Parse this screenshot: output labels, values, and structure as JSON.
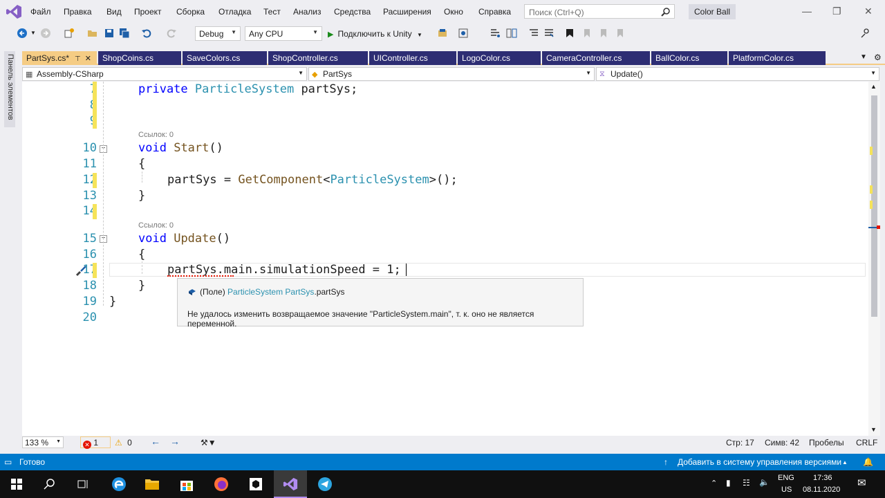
{
  "menu": {
    "items": [
      "Файл",
      "Правка",
      "Вид",
      "Проект",
      "Сборка",
      "Отладка",
      "Тест",
      "Анализ",
      "Средства",
      "Расширения",
      "Окно",
      "Справка"
    ],
    "search_placeholder": "Поиск (Ctrl+Q)",
    "solution_name": "Color Ball"
  },
  "toolbar": {
    "config": "Debug",
    "platform": "Any CPU",
    "attach_label": "Подключить к Unity"
  },
  "toolbox_label": "Панель элементов",
  "tabs": [
    {
      "label": "PartSys.cs*",
      "active": true
    },
    {
      "label": "ShopCoins.cs"
    },
    {
      "label": "SaveColors.cs"
    },
    {
      "label": "ShopController.cs"
    },
    {
      "label": "UIController.cs"
    },
    {
      "label": "LogoColor.cs"
    },
    {
      "label": "CameraController.cs"
    },
    {
      "label": "BallColor.cs"
    },
    {
      "label": "PlatformColor.cs"
    }
  ],
  "navbar": {
    "project": "Assembly-CSharp",
    "class": "PartSys",
    "member": "Update()"
  },
  "editor": {
    "line_numbers": [
      "7",
      "8",
      "9",
      "10",
      "11",
      "12",
      "13",
      "14",
      "15",
      "16",
      "17",
      "18",
      "19",
      "20"
    ],
    "codelens": "Ссылок: 0",
    "lines": {
      "l7_kw": "private",
      "l7_type": "ParticleSystem",
      "l7_rest": " partSys;",
      "l10_kw": "void",
      "l10_fn": "Start",
      "l10_rest": "()",
      "l11": "{",
      "l12_a": "partSys = ",
      "l12_fn": "GetComponent",
      "l12_b": "<",
      "l12_type": "ParticleSystem",
      "l12_c": ">();",
      "l13": "}",
      "l15_kw": "void",
      "l15_fn": "Update",
      "l15_rest": "()",
      "l16": "{",
      "l17": "partSys.main.simulationSpeed = 1;",
      "l18": "}",
      "l19": "}"
    }
  },
  "tooltip": {
    "prefix": "(Поле) ",
    "type": "ParticleSystem",
    "class": " PartSys",
    "member": ".partSys",
    "message": "Не удалось изменить возвращаемое значение \"ParticleSystem.main\", т. к. оно не является переменной."
  },
  "editor_status": {
    "zoom": "133 %",
    "errors": "1",
    "warnings": "0",
    "line": "Стр: 17",
    "col": "Симв: 42",
    "spaces": "Пробелы",
    "eol": "CRLF"
  },
  "statusbar": {
    "state": "Готово",
    "vcs": "Добавить в систему управления версиями"
  },
  "taskbar": {
    "lang": "ENG",
    "layout": "US",
    "time": "17:36",
    "date": "08.11.2020"
  },
  "colors": {
    "accent": "#007acc",
    "tab_active": "#f5cc84",
    "tab_inactive": "#2d2d73",
    "vs_purple": "#865fc5"
  }
}
